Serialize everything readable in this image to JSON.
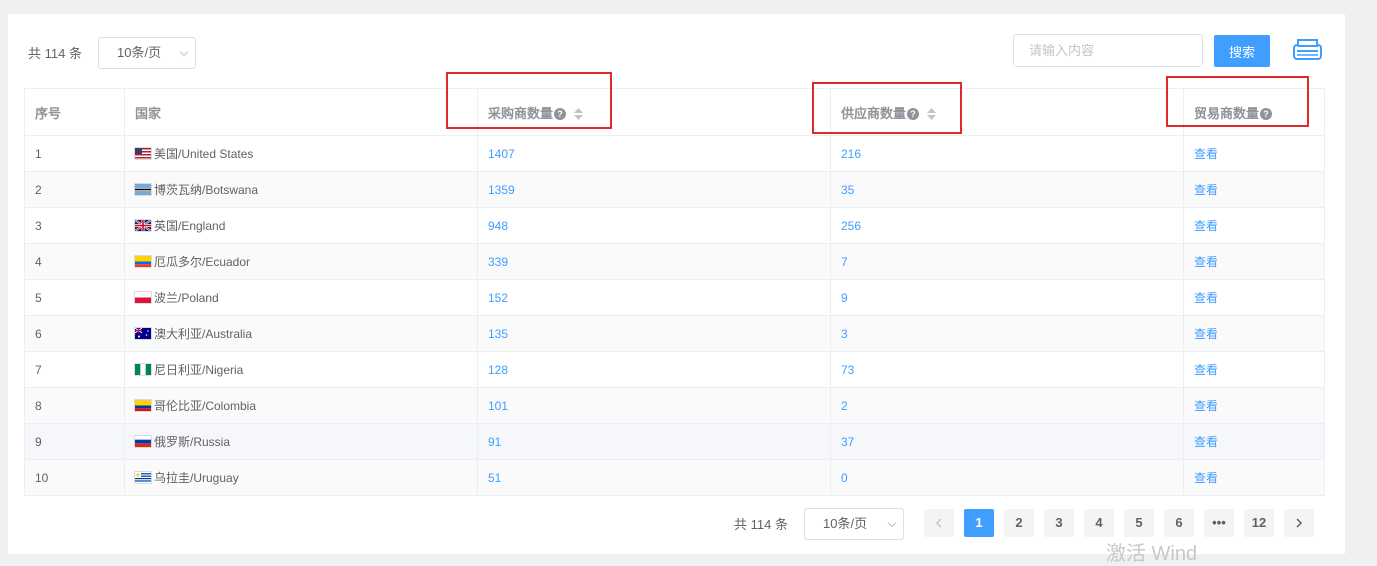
{
  "toolbar": {
    "total_text": "共 114 条",
    "page_size": "10条/页",
    "search_placeholder": "请输入内容",
    "search_button": "搜索"
  },
  "table": {
    "headers": {
      "index": "序号",
      "country": "国家",
      "buyers": "采购商数量",
      "suppliers": "供应商数量",
      "traders": "贸易商数量"
    },
    "rows": [
      {
        "index": "1",
        "flag": "us",
        "country": "美国/United States",
        "buyers": "1407",
        "suppliers": "216",
        "action": "查看"
      },
      {
        "index": "2",
        "flag": "bw",
        "country": "博茨瓦纳/Botswana",
        "buyers": "1359",
        "suppliers": "35",
        "action": "查看"
      },
      {
        "index": "3",
        "flag": "gb",
        "country": "英国/England",
        "buyers": "948",
        "suppliers": "256",
        "action": "查看"
      },
      {
        "index": "4",
        "flag": "ec",
        "country": "厄瓜多尔/Ecuador",
        "buyers": "339",
        "suppliers": "7",
        "action": "查看"
      },
      {
        "index": "5",
        "flag": "pl",
        "country": "波兰/Poland",
        "buyers": "152",
        "suppliers": "9",
        "action": "查看"
      },
      {
        "index": "6",
        "flag": "au",
        "country": "澳大利亚/Australia",
        "buyers": "135",
        "suppliers": "3",
        "action": "查看"
      },
      {
        "index": "7",
        "flag": "ng",
        "country": "尼日利亚/Nigeria",
        "buyers": "128",
        "suppliers": "73",
        "action": "查看"
      },
      {
        "index": "8",
        "flag": "co",
        "country": "哥伦比亚/Colombia",
        "buyers": "101",
        "suppliers": "2",
        "action": "查看"
      },
      {
        "index": "9",
        "flag": "ru",
        "country": "俄罗斯/Russia",
        "buyers": "91",
        "suppliers": "37",
        "action": "查看"
      },
      {
        "index": "10",
        "flag": "uy",
        "country": "乌拉圭/Uruguay",
        "buyers": "51",
        "suppliers": "0",
        "action": "查看"
      }
    ]
  },
  "pagination": {
    "total_text": "共 114 条",
    "page_size": "10条/页",
    "pages": [
      "1",
      "2",
      "3",
      "4",
      "5",
      "6",
      "•••",
      "12"
    ],
    "current": "1"
  },
  "watermark": "激活 Wind",
  "colors": {
    "accent": "#409eff",
    "highlight_box": "#e02a2a"
  }
}
